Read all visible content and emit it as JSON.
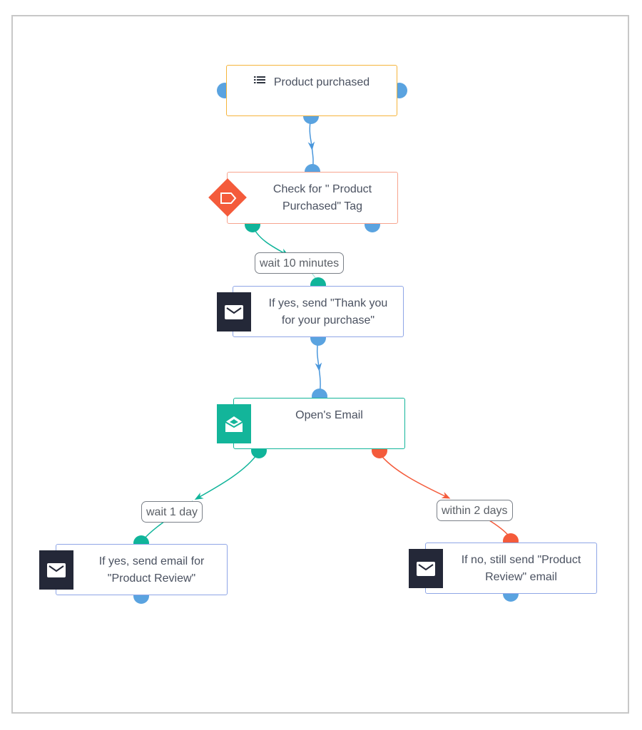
{
  "diagram": {
    "type": "email-automation-workflow",
    "nodes": [
      {
        "id": "trigger",
        "label": "Product purchased",
        "icon": "list-icon",
        "border_color": "#f5b43c"
      },
      {
        "id": "check-tag",
        "label_line1": "Check for \" Product",
        "label_line2": "Purchased\" Tag",
        "icon": "tag-icon",
        "border_color": "#f7a48e"
      },
      {
        "id": "thank-you",
        "label_line1": "If yes, send \"Thank you",
        "label_line2": "for your purchase\"",
        "icon": "envelope-icon",
        "border_color": "#8fa6e6"
      },
      {
        "id": "opens-email",
        "label": "Open's Email",
        "icon": "open-envelope-icon",
        "border_color": "#13b59a"
      },
      {
        "id": "review-yes",
        "label_line1": "If yes, send email for",
        "label_line2": "\"Product Review\"",
        "icon": "envelope-icon",
        "border_color": "#8fa6e6"
      },
      {
        "id": "review-no",
        "label_line1": "If no, still send \"Product",
        "label_line2": "Review\" email",
        "icon": "envelope-icon",
        "border_color": "#8fa6e6"
      }
    ],
    "edges": [
      {
        "from": "trigger",
        "to": "check-tag",
        "label": "",
        "color": "#4a97dc"
      },
      {
        "from": "check-tag",
        "to": "thank-you",
        "label": "wait 10 minutes",
        "color": "#10b49a"
      },
      {
        "from": "thank-you",
        "to": "opens-email",
        "label": "",
        "color": "#4a97dc"
      },
      {
        "from": "opens-email",
        "to": "review-yes",
        "label": "wait 1 day",
        "color": "#10b49a"
      },
      {
        "from": "opens-email",
        "to": "review-no",
        "label": "within 2 days",
        "color": "#f45b3b"
      }
    ]
  },
  "colors": {
    "port_blue": "#5aa3e0",
    "port_green": "#10b49a",
    "port_red": "#f45b3b",
    "icon_dark": "#242838",
    "icon_teal": "#13b59a",
    "tag_red": "#f45b3b"
  }
}
